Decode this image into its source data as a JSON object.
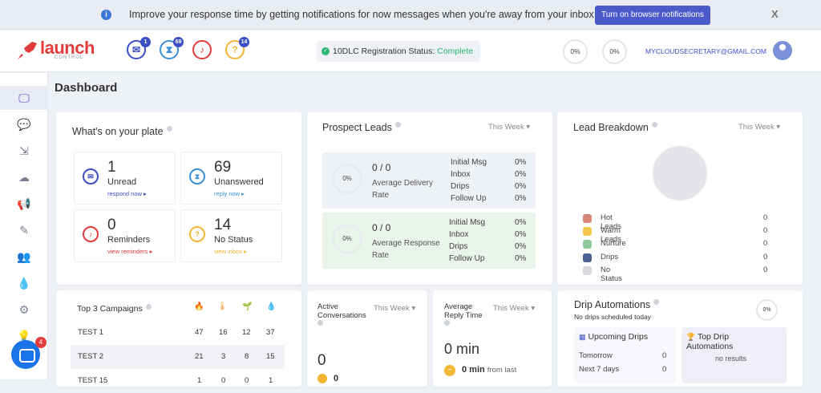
{
  "banner": {
    "message": "Improve your response time by getting notifications for now messages when you're away from your inbox.",
    "button_label": "Turn on browser notifications",
    "close_label": "X"
  },
  "header": {
    "logo_text": "launch",
    "logo_sub": "CONTROL",
    "badges": {
      "messages": "1",
      "unanswered": "69",
      "reminders": "",
      "no_status": "14"
    },
    "registration_label": "10DLC Registration Status:",
    "registration_status": "Complete",
    "pct1": "0%",
    "pct2": "0%",
    "email": "MYCLOUDSECRETARY@GMAIL.COM"
  },
  "page_title": "Dashboard",
  "plate": {
    "title": "What's on your plate",
    "tiles": [
      {
        "num": "1",
        "label": "Unread",
        "link": "respond now ▸"
      },
      {
        "num": "69",
        "label": "Unanswered",
        "link": "reply now ▸"
      },
      {
        "num": "0",
        "label": "Reminders",
        "link": "view reminders ▸"
      },
      {
        "num": "14",
        "label": "No Status",
        "link": "view inbox ▸"
      }
    ]
  },
  "prospect": {
    "title": "Prospect Leads",
    "period": "This Week ▾",
    "delivery": {
      "pct": "0%",
      "ratio": "0 / 0",
      "caption1": "Average Delivery",
      "caption2": "Rate",
      "rows": [
        [
          "Initial Msg",
          "0%"
        ],
        [
          "Inbox",
          "0%"
        ],
        [
          "Drips",
          "0%"
        ],
        [
          "Follow Up",
          "0%"
        ]
      ]
    },
    "response": {
      "pct": "0%",
      "ratio": "0 / 0",
      "caption1": "Average Response",
      "caption2": "Rate",
      "rows": [
        [
          "Initial Msg",
          "0%"
        ],
        [
          "Inbox",
          "0%"
        ],
        [
          "Drips",
          "0%"
        ],
        [
          "Follow Up",
          "0%"
        ]
      ]
    }
  },
  "breakdown": {
    "title": "Lead Breakdown",
    "period": "This Week ▾",
    "items": [
      {
        "label": "Hot Leads",
        "value": "0",
        "color": "#d98474"
      },
      {
        "label": "Warm Leads",
        "value": "0",
        "color": "#f2c94c"
      },
      {
        "label": "Nurture",
        "value": "0",
        "color": "#8fc89a"
      },
      {
        "label": "Drips",
        "value": "0",
        "color": "#4a6394"
      },
      {
        "label": "No Status",
        "value": "0",
        "color": "#d7d9de"
      }
    ]
  },
  "campaigns": {
    "title": "Top 3 Campaigns",
    "rows": [
      {
        "name": "TEST 1",
        "a": "47",
        "b": "16",
        "c": "12",
        "d": "37"
      },
      {
        "name": "TEST 2",
        "a": "21",
        "b": "3",
        "c": "8",
        "d": "15"
      },
      {
        "name": "TEST 15 ",
        "a": "1",
        "b": "0",
        "c": "0",
        "d": "1"
      }
    ]
  },
  "active": {
    "title1": "Active",
    "title2": "Conversations",
    "period": "This Week ▾",
    "value": "0",
    "sub_value": "0"
  },
  "reply": {
    "title1": "Average",
    "title2": "Reply Time",
    "period": "This Week ▾",
    "value": "0 min",
    "sub_value": "0 min",
    "sub_text": "from last"
  },
  "drip": {
    "title": "Drip Automations",
    "subtitle": "No drips scheduled today",
    "pct": "0%",
    "upcoming_title": "Upcoming Drips",
    "upcoming": [
      [
        "Tomorrow",
        "0"
      ],
      [
        "Next 7 days",
        "0"
      ]
    ],
    "top_title1": "Top Drip",
    "top_title2": "Automations",
    "top_empty": "no results"
  },
  "chat_badge": "4"
}
